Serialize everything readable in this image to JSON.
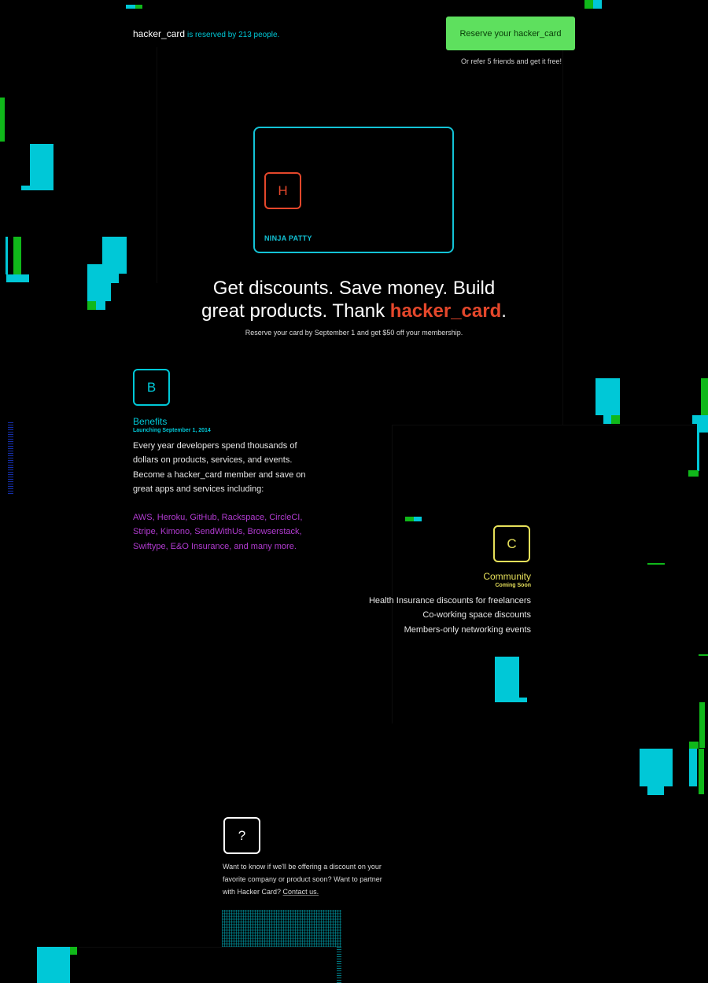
{
  "header": {
    "brand": "hacker_card",
    "reserved_text": "is reserved by 213 people.",
    "cta_label": "Reserve your hacker_card",
    "refer_text": "Or refer 5 friends and get it free!"
  },
  "card": {
    "initial": "H",
    "holder": "NINJA PATTY"
  },
  "hero": {
    "headline_line1": "Get discounts. Save money. Build",
    "headline_line2_prefix": "great products. Thank ",
    "headline_accent": "hacker_card",
    "headline_suffix": ".",
    "subline": "Reserve your card by September 1 and get $50 off your membership."
  },
  "benefits": {
    "icon_letter": "B",
    "title": "Benefits",
    "subtitle": "Launching September 1, 2014",
    "body": "Every year developers spend thousands of dollars on products, services, and events. Become a hacker_card member and save on great apps and services including:",
    "partners": "AWS, Heroku, GitHub, Rackspace, CircleCI, Stripe, Kimono, SendWithUs, Browserstack, Swiftype, E&O Insurance, and many more."
  },
  "community": {
    "icon_letter": "C",
    "title": "Community",
    "subtitle": "Coming Soon",
    "items": [
      "Health Insurance discounts for freelancers",
      "Co-working space discounts",
      "Members-only networking events"
    ]
  },
  "contact": {
    "icon_letter": "?",
    "body": "Want to know if we'll be offering a discount on your favorite company or product soon? Want to partner with Hacker Card?",
    "link_text": "Contact us."
  },
  "colors": {
    "background": "#000000",
    "cyan": "#00c8d7",
    "green": "#10b81a",
    "cta_green": "#5ee05e",
    "accent_red": "#e4472b",
    "purple": "#b13bd0",
    "yellow": "#e6e05a"
  }
}
